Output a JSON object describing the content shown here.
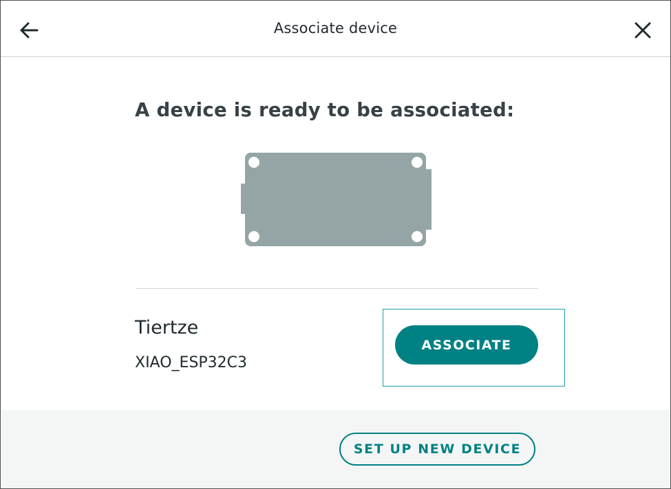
{
  "header": {
    "title": "Associate device",
    "back_icon": "arrow-left-icon",
    "close_icon": "close-icon"
  },
  "main": {
    "heading": "A device is ready to be associated:",
    "board_image": "board-icon",
    "device": {
      "name": "Tiertze",
      "type": "XIAO_ESP32C3"
    },
    "associate_label": "ASSOCIATE"
  },
  "footer": {
    "setup_label": "SET UP NEW DEVICE"
  },
  "colors": {
    "accent": "#008184",
    "heading": "#374146",
    "board": "#95a5a6",
    "footer_bg": "#f4f6f6"
  }
}
